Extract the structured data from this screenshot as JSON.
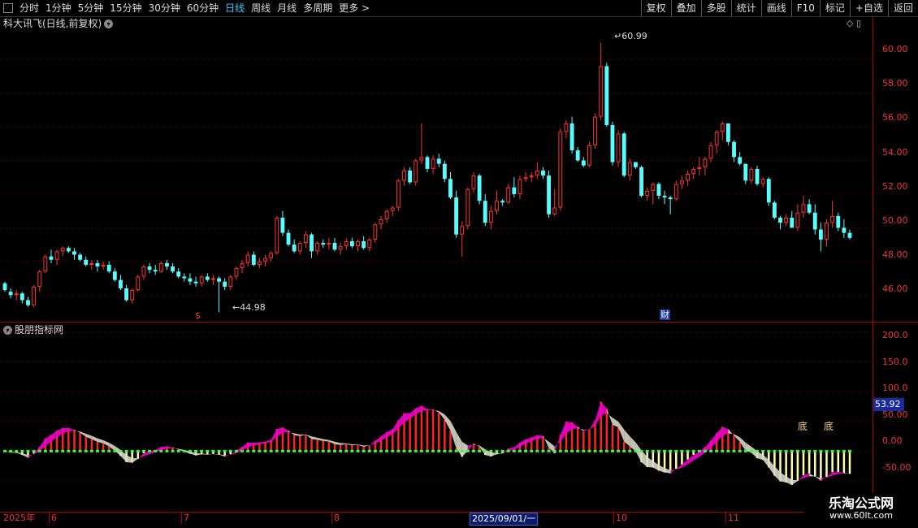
{
  "toolbar": {
    "periods": [
      "分时",
      "1分钟",
      "5分钟",
      "15分钟",
      "30分钟",
      "60分钟",
      "日线",
      "周线",
      "月线",
      "多周期",
      "更多 >"
    ],
    "active": "日线",
    "right_buttons": [
      "复权",
      "叠加",
      "多股",
      "统计",
      "画线",
      "F10",
      "标记",
      "+自选",
      "返回"
    ]
  },
  "main_title": "科大讯飞(日线,前复权)",
  "indicator_title": "股朋指标网",
  "price_axis": [
    "60.00",
    "58.00",
    "56.00",
    "54.00",
    "52.00",
    "50.00",
    "48.00",
    "46.00"
  ],
  "ind_axis": [
    "200.0",
    "150.0",
    "100.0",
    "50.00",
    "0.00",
    "-50.00"
  ],
  "high_label": "60.99",
  "low_label": "44.98",
  "current_value": "53.92",
  "bottom_labels": {
    "year": "2025年",
    "months": [
      "6",
      "7",
      "8",
      "10",
      "11"
    ],
    "cursor_date": "2025/09/01/一"
  },
  "markers": {
    "dollar": "$",
    "cai": "财",
    "di": [
      "底",
      "底"
    ]
  },
  "watermark": {
    "line1": "乐淘公式网",
    "line2": "www.60lt.com"
  },
  "colors": {
    "up": "#ff3333",
    "down": "#55ffff",
    "magenta": "#ee00cc",
    "grid": "#8b0000"
  },
  "chart_data": {
    "type": "candlestick",
    "candles": [
      [
        46.7,
        46.8,
        46.2,
        46.3
      ],
      [
        46.2,
        46.4,
        45.8,
        46.0
      ],
      [
        46.0,
        46.3,
        45.7,
        46.1
      ],
      [
        46.1,
        46.2,
        45.5,
        45.7
      ],
      [
        45.7,
        45.9,
        45.3,
        45.4
      ],
      [
        45.4,
        46.6,
        45.3,
        46.5
      ],
      [
        46.5,
        47.5,
        46.2,
        47.4
      ],
      [
        47.4,
        48.4,
        47.3,
        48.3
      ],
      [
        48.3,
        48.7,
        47.9,
        48.1
      ],
      [
        48.1,
        48.7,
        47.8,
        48.6
      ],
      [
        48.6,
        48.9,
        48.3,
        48.8
      ],
      [
        48.8,
        48.9,
        48.5,
        48.6
      ],
      [
        48.6,
        48.8,
        48.1,
        48.4
      ],
      [
        48.4,
        48.5,
        48.0,
        48.1
      ],
      [
        48.1,
        48.3,
        47.7,
        47.8
      ],
      [
        47.8,
        48.1,
        47.5,
        47.9
      ],
      [
        47.9,
        48.1,
        47.4,
        47.7
      ],
      [
        47.7,
        48.0,
        47.5,
        47.8
      ],
      [
        47.8,
        48.0,
        47.3,
        47.4
      ],
      [
        47.4,
        47.6,
        46.8,
        46.9
      ],
      [
        46.9,
        47.2,
        46.3,
        46.4
      ],
      [
        46.4,
        46.6,
        45.6,
        45.7
      ],
      [
        45.7,
        46.4,
        45.5,
        46.3
      ],
      [
        46.3,
        47.2,
        46.2,
        47.1
      ],
      [
        47.1,
        47.8,
        46.9,
        47.7
      ],
      [
        47.7,
        47.9,
        47.3,
        47.5
      ],
      [
        47.5,
        47.8,
        47.2,
        47.4
      ],
      [
        47.4,
        48.0,
        47.3,
        47.9
      ],
      [
        47.9,
        48.1,
        47.5,
        47.7
      ],
      [
        47.7,
        47.9,
        47.3,
        47.4
      ],
      [
        47.4,
        47.6,
        47.0,
        47.1
      ],
      [
        47.1,
        47.3,
        46.8,
        47.0
      ],
      [
        47.0,
        47.3,
        46.6,
        46.8
      ],
      [
        46.8,
        47.1,
        46.5,
        46.7
      ],
      [
        46.7,
        47.2,
        46.5,
        47.1
      ],
      [
        47.1,
        47.3,
        46.8,
        46.9
      ],
      [
        46.9,
        47.2,
        46.6,
        47.0
      ],
      [
        47.0,
        47.1,
        44.98,
        46.8
      ],
      [
        46.8,
        47.0,
        46.3,
        46.5
      ],
      [
        46.5,
        47.2,
        46.3,
        47.1
      ],
      [
        47.1,
        47.7,
        46.9,
        47.6
      ],
      [
        47.6,
        48.1,
        47.3,
        47.9
      ],
      [
        47.9,
        48.6,
        47.7,
        48.4
      ],
      [
        48.4,
        48.6,
        47.7,
        47.8
      ],
      [
        47.8,
        48.2,
        47.6,
        48.0
      ],
      [
        48.0,
        48.4,
        47.7,
        48.2
      ],
      [
        48.2,
        48.6,
        48.0,
        48.5
      ],
      [
        48.5,
        50.7,
        48.4,
        50.6
      ],
      [
        50.6,
        51.0,
        49.5,
        49.7
      ],
      [
        49.7,
        49.9,
        48.9,
        49.0
      ],
      [
        49.0,
        49.3,
        48.5,
        48.6
      ],
      [
        48.6,
        49.2,
        48.4,
        49.1
      ],
      [
        49.1,
        49.8,
        48.8,
        49.6
      ],
      [
        49.6,
        49.7,
        48.2,
        48.6
      ],
      [
        48.6,
        49.2,
        48.4,
        49.1
      ],
      [
        49.1,
        49.3,
        48.8,
        49.0
      ],
      [
        49.0,
        49.4,
        48.7,
        49.1
      ],
      [
        49.1,
        49.4,
        48.6,
        48.7
      ],
      [
        48.7,
        49.1,
        48.4,
        48.9
      ],
      [
        48.9,
        49.4,
        48.7,
        49.2
      ],
      [
        49.2,
        49.4,
        48.8,
        48.9
      ],
      [
        48.9,
        49.3,
        48.6,
        49.2
      ],
      [
        49.2,
        49.5,
        48.7,
        48.8
      ],
      [
        48.8,
        49.4,
        48.6,
        49.3
      ],
      [
        49.3,
        50.3,
        49.1,
        50.2
      ],
      [
        50.2,
        50.7,
        49.9,
        50.5
      ],
      [
        50.5,
        51.1,
        50.3,
        51.0
      ],
      [
        51.0,
        51.3,
        50.7,
        51.2
      ],
      [
        51.2,
        52.9,
        51.0,
        52.8
      ],
      [
        52.8,
        53.6,
        52.5,
        53.4
      ],
      [
        53.4,
        53.6,
        52.6,
        52.7
      ],
      [
        52.7,
        54.1,
        52.5,
        54.0
      ],
      [
        54.0,
        56.2,
        53.8,
        54.2
      ],
      [
        54.2,
        54.3,
        53.3,
        53.5
      ],
      [
        53.5,
        54.3,
        53.2,
        54.1
      ],
      [
        54.1,
        54.4,
        53.6,
        53.8
      ],
      [
        53.8,
        54.0,
        52.7,
        52.9
      ],
      [
        52.9,
        53.3,
        51.7,
        51.8
      ],
      [
        51.8,
        52.2,
        49.4,
        49.6
      ],
      [
        49.6,
        50.4,
        48.3,
        50.1
      ],
      [
        50.1,
        52.4,
        49.9,
        52.3
      ],
      [
        52.3,
        53.3,
        52.1,
        53.1
      ],
      [
        53.1,
        53.2,
        51.4,
        51.6
      ],
      [
        51.6,
        52.0,
        50.1,
        50.3
      ],
      [
        50.3,
        51.3,
        49.9,
        51.0
      ],
      [
        51.0,
        52.2,
        50.8,
        51.6
      ],
      [
        51.6,
        51.7,
        51.3,
        51.5
      ],
      [
        51.5,
        52.6,
        51.4,
        52.4
      ],
      [
        52.4,
        53.0,
        51.8,
        52.0
      ],
      [
        52.0,
        53.1,
        51.7,
        52.9
      ],
      [
        52.9,
        53.3,
        52.7,
        53.0
      ],
      [
        53.0,
        53.3,
        52.7,
        53.1
      ],
      [
        53.1,
        53.9,
        52.9,
        53.4
      ],
      [
        53.4,
        53.6,
        52.9,
        53.1
      ],
      [
        53.1,
        53.4,
        50.6,
        50.8
      ],
      [
        50.8,
        52.3,
        50.7,
        51.2
      ],
      [
        51.2,
        55.9,
        51.0,
        55.7
      ],
      [
        55.7,
        56.4,
        55.3,
        56.2
      ],
      [
        56.2,
        56.6,
        54.4,
        54.6
      ],
      [
        54.6,
        54.8,
        53.9,
        54.0
      ],
      [
        54.0,
        54.2,
        53.6,
        53.7
      ],
      [
        53.7,
        55.1,
        53.6,
        54.9
      ],
      [
        54.9,
        56.8,
        54.7,
        56.6
      ],
      [
        56.6,
        60.99,
        56.4,
        59.6
      ],
      [
        59.6,
        59.8,
        56.0,
        56.1
      ],
      [
        56.1,
        56.3,
        53.7,
        53.9
      ],
      [
        53.9,
        55.8,
        53.6,
        55.6
      ],
      [
        55.6,
        55.7,
        53.0,
        53.1
      ],
      [
        53.1,
        54.1,
        52.8,
        53.9
      ],
      [
        53.9,
        53.9,
        53.5,
        53.6
      ],
      [
        53.6,
        53.7,
        51.8,
        51.9
      ],
      [
        51.9,
        52.4,
        51.6,
        52.2
      ],
      [
        52.2,
        52.7,
        51.4,
        52.6
      ],
      [
        52.6,
        52.7,
        51.7,
        51.9
      ],
      [
        51.9,
        52.2,
        51.4,
        51.8
      ],
      [
        51.8,
        51.9,
        50.8,
        51.7
      ],
      [
        51.7,
        52.8,
        51.6,
        52.6
      ],
      [
        52.6,
        53.1,
        52.3,
        52.8
      ],
      [
        52.8,
        53.4,
        52.5,
        53.2
      ],
      [
        53.2,
        53.6,
        52.9,
        53.5
      ],
      [
        53.5,
        54.2,
        53.1,
        53.6
      ],
      [
        53.6,
        54.2,
        53.1,
        54.1
      ],
      [
        54.1,
        55.1,
        53.9,
        54.9
      ],
      [
        54.9,
        55.8,
        54.4,
        55.7
      ],
      [
        55.7,
        56.3,
        55.2,
        56.2
      ],
      [
        56.2,
        56.2,
        54.9,
        55.1
      ],
      [
        55.1,
        55.2,
        53.9,
        54.2
      ],
      [
        54.2,
        54.5,
        53.7,
        53.8
      ],
      [
        53.8,
        53.8,
        52.6,
        52.8
      ],
      [
        52.8,
        53.6,
        52.6,
        53.5
      ],
      [
        53.5,
        53.7,
        52.5,
        52.6
      ],
      [
        52.6,
        53.0,
        52.4,
        52.9
      ],
      [
        52.9,
        53.0,
        51.3,
        51.5
      ],
      [
        51.5,
        51.6,
        50.5,
        50.6
      ],
      [
        50.6,
        50.7,
        49.9,
        50.3
      ],
      [
        50.3,
        50.8,
        50.1,
        50.6
      ],
      [
        50.6,
        51.0,
        50.4,
        50.0
      ],
      [
        50.0,
        51.4,
        49.8,
        50.9
      ],
      [
        50.9,
        51.9,
        50.6,
        51.4
      ],
      [
        51.4,
        51.7,
        50.8,
        50.9
      ],
      [
        50.9,
        51.4,
        49.6,
        49.9
      ],
      [
        49.9,
        50.3,
        48.6,
        49.3
      ],
      [
        49.3,
        50.5,
        48.9,
        50.3
      ],
      [
        50.3,
        51.6,
        50.0,
        50.7
      ],
      [
        50.7,
        50.9,
        49.8,
        50.0
      ],
      [
        50.0,
        50.5,
        49.4,
        49.7
      ],
      [
        49.7,
        49.9,
        49.3,
        49.4
      ]
    ],
    "y_range": [
      45.0,
      61.6
    ],
    "indicator_range": [
      -95,
      205
    ]
  }
}
